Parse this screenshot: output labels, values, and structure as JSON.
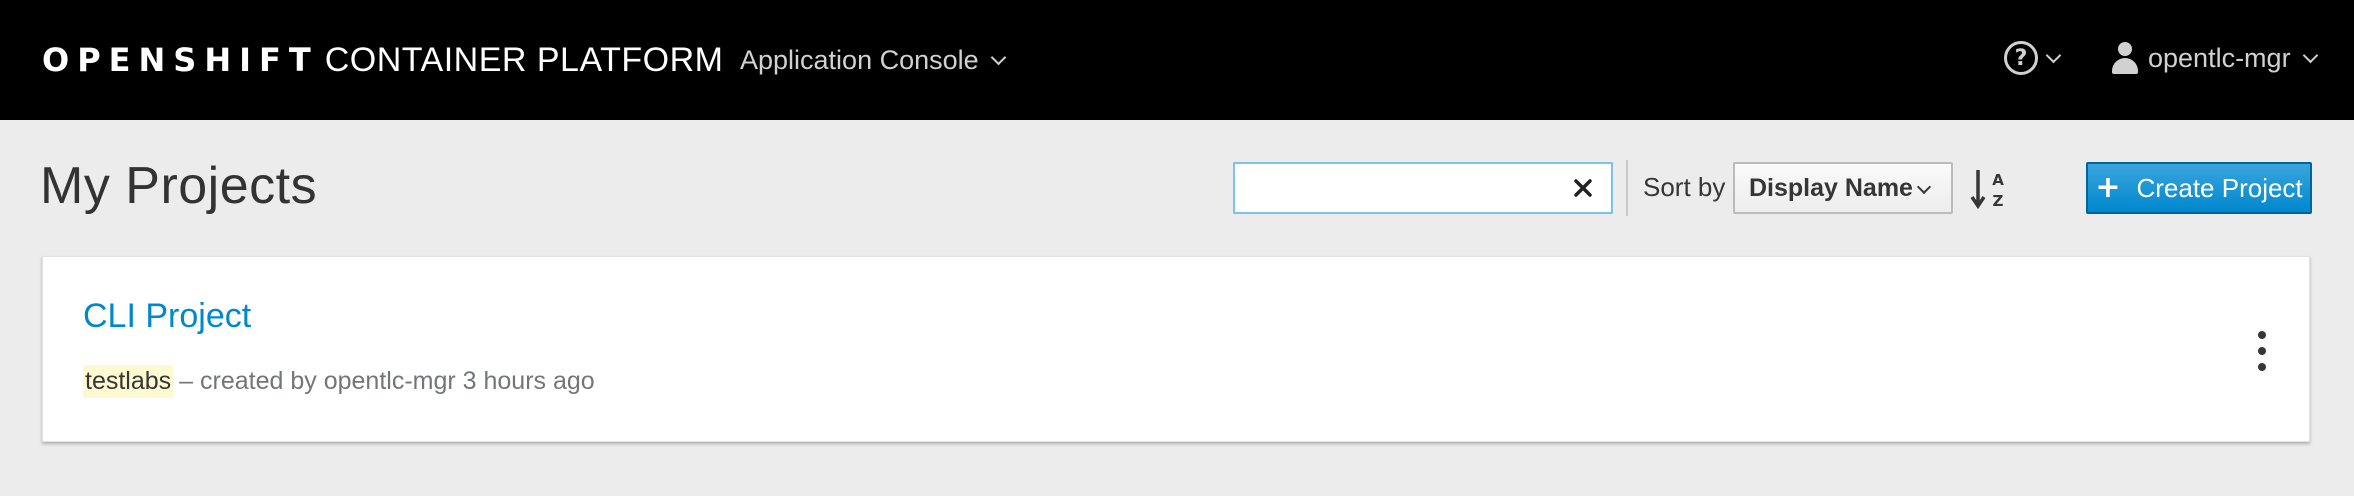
{
  "header": {
    "brand_bold": "OPENSHIFT",
    "brand_light": "CONTAINER PLATFORM",
    "app_switcher_label": "Application Console",
    "help_icon": "question-circle-icon",
    "user_icon": "user-icon",
    "user_name": "opentlc-mgr"
  },
  "toolbar": {
    "page_title": "My Projects",
    "search_value": "",
    "clear_icon": "close-icon",
    "sort_label": "Sort by",
    "sort_selected": "Display Name",
    "sort_order_icon": "sort-alpha-asc-icon",
    "create_label": "Create Project",
    "create_icon": "plus-icon"
  },
  "projects": [
    {
      "display_name": "CLI Project",
      "name": "testlabs",
      "created_by_text": "– created by opentlc-mgr 3 hours ago",
      "actions_icon": "kebab-icon"
    }
  ],
  "colors": {
    "nav_bg": "#000000",
    "page_bg": "#ececec",
    "link": "#0088ce",
    "primary_button": "#0088ce",
    "highlight": "#fdf9d0"
  }
}
